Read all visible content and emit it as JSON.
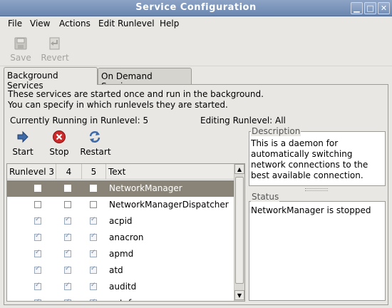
{
  "window": {
    "title": "Service Configuration"
  },
  "menu": {
    "file": "File",
    "view": "View",
    "actions": "Actions",
    "edit_runlevel": "Edit Runlevel",
    "help": "Help"
  },
  "toolbar": {
    "save": "Save",
    "revert": "Revert"
  },
  "tabs": {
    "background": "Background Services",
    "on_demand": "On Demand Services"
  },
  "info": {
    "line1": "These services are started once and run in the background.",
    "line2": "You can specify in which runlevels they are started.",
    "running": "Currently Running in Runlevel: 5",
    "editing": "Editing Runlevel: All"
  },
  "actions": {
    "start": "Start",
    "stop": "Stop",
    "restart": "Restart"
  },
  "columns": {
    "runlevel3": "Runlevel 3",
    "r4": "4",
    "r5": "5",
    "text": "Text"
  },
  "services": [
    {
      "name": "NetworkManager",
      "r3": false,
      "r4": false,
      "r5": false,
      "selected": true
    },
    {
      "name": "NetworkManagerDispatcher",
      "r3": false,
      "r4": false,
      "r5": false,
      "selected": false
    },
    {
      "name": "acpid",
      "r3": true,
      "r4": true,
      "r5": true,
      "selected": false
    },
    {
      "name": "anacron",
      "r3": true,
      "r4": true,
      "r5": true,
      "selected": false
    },
    {
      "name": "apmd",
      "r3": true,
      "r4": true,
      "r5": true,
      "selected": false
    },
    {
      "name": "atd",
      "r3": true,
      "r4": true,
      "r5": true,
      "selected": false
    },
    {
      "name": "auditd",
      "r3": true,
      "r4": true,
      "r5": true,
      "selected": false
    },
    {
      "name": "autofs",
      "r3": true,
      "r4": true,
      "r5": true,
      "selected": false
    }
  ],
  "description": {
    "title": "Description",
    "line1": "This is a daemon for",
    "line2": "automatically switching",
    "line3": "network connections to the",
    "line4": "best available connection."
  },
  "status": {
    "title": "Status",
    "text": "NetworkManager is stopped"
  },
  "icons": {
    "save": "save-icon",
    "revert": "revert-icon",
    "start": "start-arrow-icon",
    "stop": "stop-icon",
    "restart": "restart-icon"
  }
}
